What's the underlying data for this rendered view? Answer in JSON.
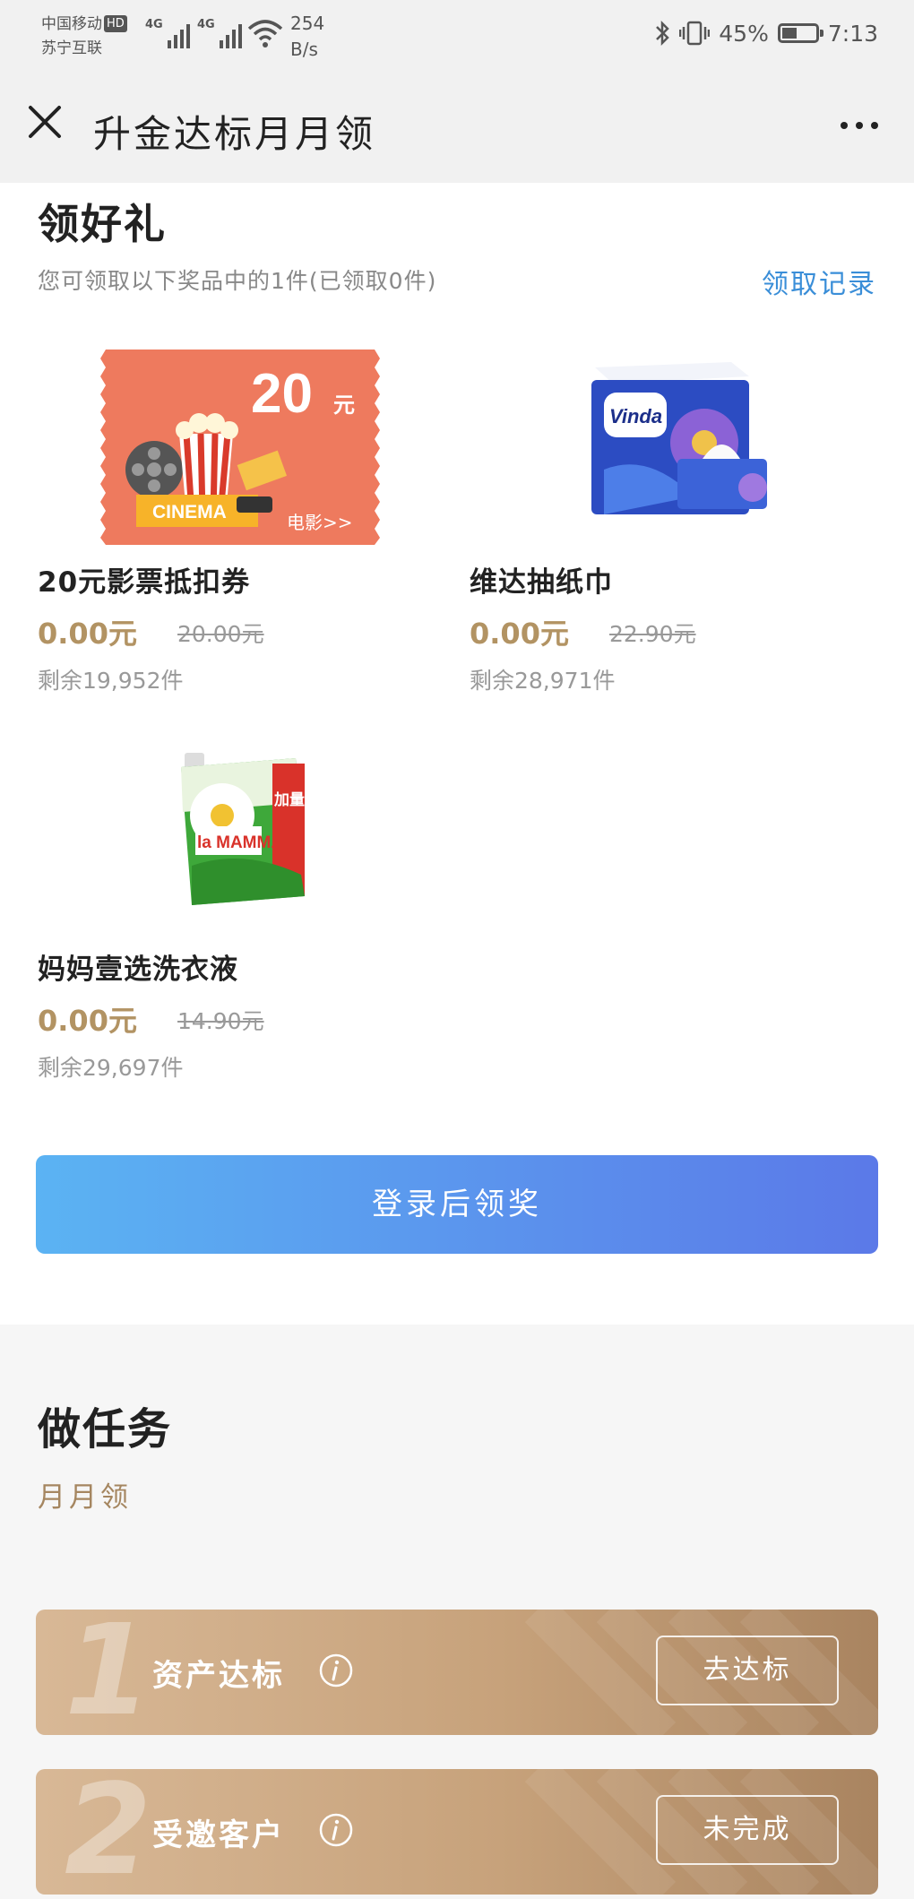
{
  "status_bar": {
    "carrier1": "中国移动",
    "hd": "HD",
    "carrier2": "苏宁互联",
    "net1": "4G",
    "net2": "4G",
    "speed_value": "254",
    "speed_unit": "B/s",
    "battery_percent": "45%",
    "battery_level": 0.45,
    "time": "7:13"
  },
  "nav": {
    "title": "升金达标月月领",
    "close_icon": "close-icon",
    "more_icon": "more-icon"
  },
  "gifts": {
    "title": "领好礼",
    "subtitle": "您可领取以下奖品中的1件(已领取0件)",
    "record_link": "领取记录",
    "items": [
      {
        "name": "20元影票抵扣券",
        "price": "0.00元",
        "original_price": "20.00元",
        "stock": "剩余19,952件",
        "image": {
          "amount": "20",
          "unit": "元",
          "cinema": "CINEMA",
          "caption": "电影>>",
          "bg_color": "#ee7a5e"
        }
      },
      {
        "name": "维达抽纸巾",
        "price": "0.00元",
        "original_price": "22.90元",
        "stock": "剩余28,971件",
        "image": {
          "brand": "Vinda",
          "color": "#2c4cc2"
        }
      },
      {
        "name": "妈妈壹选洗衣液",
        "price": "0.00元",
        "original_price": "14.90元",
        "stock": "剩余29,697件",
        "image": {
          "brand": "la MAMMA",
          "tag": "加量",
          "color": "#3ea83a"
        }
      }
    ],
    "login_button": "登录后领奖"
  },
  "tasks": {
    "title": "做任务",
    "subtitle": "月月领",
    "items": [
      {
        "number": "1",
        "name": "资产达标",
        "button": "去达标",
        "info_icon": "info-icon"
      },
      {
        "number": "2",
        "name": "受邀客户",
        "button": "未完成",
        "info_icon": "info-icon"
      }
    ]
  },
  "colors": {
    "accent_link": "#3a8ed8",
    "price_gold": "#b29363",
    "button_gradient_start": "#5bb3f3",
    "button_gradient_end": "#5b79e8",
    "task_card": "#c7a27b"
  }
}
